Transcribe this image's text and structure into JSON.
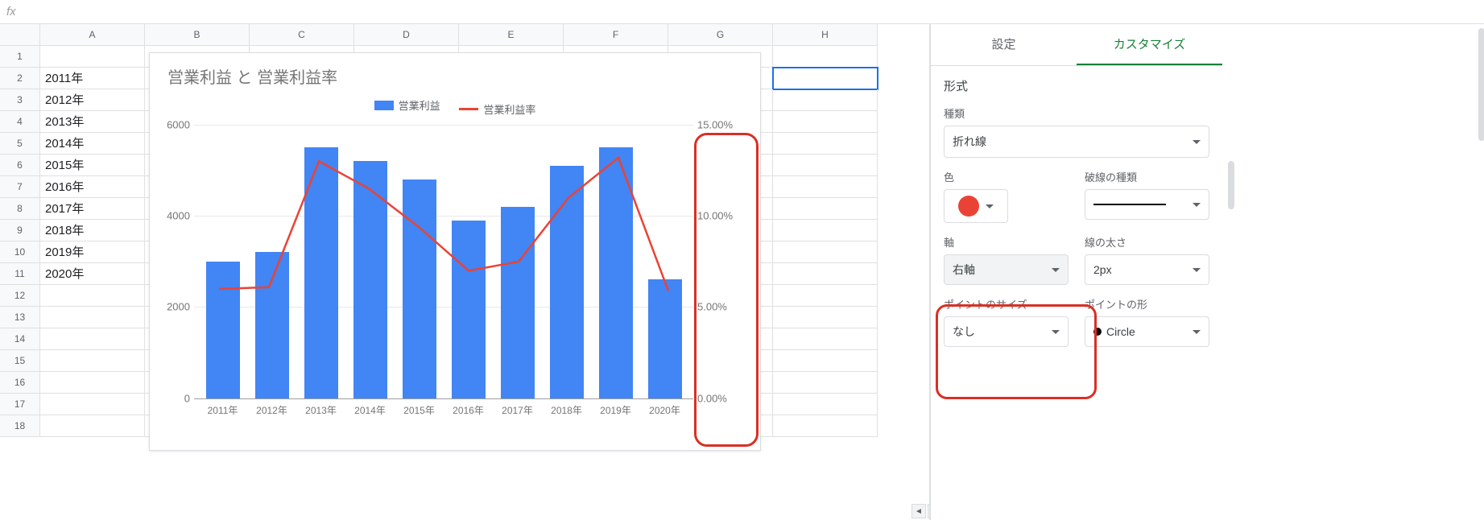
{
  "formula_bar": {
    "fx": "fx",
    "value": ""
  },
  "columns": [
    "A",
    "B",
    "C",
    "D",
    "E",
    "F",
    "G",
    "H"
  ],
  "row_numbers": [
    "1",
    "2",
    "3",
    "4",
    "5",
    "6",
    "7",
    "8",
    "9",
    "10",
    "11",
    "12",
    "13",
    "14",
    "15",
    "16",
    "17",
    "18"
  ],
  "cells_colA": [
    "",
    "2011年",
    "2012年",
    "2013年",
    "2014年",
    "2015年",
    "2016年",
    "2017年",
    "2018年",
    "2019年",
    "2020年",
    "",
    "",
    "",
    "",
    "",
    "",
    ""
  ],
  "selected_cell": "H2",
  "chart_data": {
    "type": "combo",
    "title": "営業利益 と 営業利益率",
    "series": [
      {
        "name": "営業利益",
        "type": "bar",
        "axis": "left",
        "color": "#4285f4",
        "values": [
          3000,
          3200,
          5500,
          5200,
          4800,
          3900,
          4200,
          5100,
          5500,
          2600
        ]
      },
      {
        "name": "営業利益率",
        "type": "line",
        "axis": "right",
        "color": "#ea4335",
        "values": [
          6.0,
          6.1,
          13.0,
          11.5,
          9.4,
          7.0,
          7.5,
          11.0,
          13.2,
          5.9
        ]
      }
    ],
    "categories": [
      "2011年",
      "2012年",
      "2013年",
      "2014年",
      "2015年",
      "2016年",
      "2017年",
      "2018年",
      "2019年",
      "2020年"
    ],
    "y_left": {
      "min": 0,
      "max": 6000,
      "ticks": [
        0,
        2000,
        4000,
        6000
      ]
    },
    "y_right": {
      "min": 0,
      "max": 15,
      "ticks_labels": [
        "0.00%",
        "5.00%",
        "10.00%",
        "15.00%"
      ]
    },
    "legend": {
      "bar": "営業利益",
      "line": "営業利益率"
    }
  },
  "sidebar": {
    "tabs": {
      "settings": "設定",
      "customize": "カスタマイズ"
    },
    "format_label": "形式",
    "type_label": "種類",
    "type_value": "折れ線",
    "color_label": "色",
    "dash_label": "破線の種類",
    "axis_label": "軸",
    "axis_value": "右軸",
    "line_width_label": "線の太さ",
    "line_width_value": "2px",
    "point_size_label": "ポイントのサイズ",
    "point_size_value": "なし",
    "point_shape_label": "ポイントの形",
    "point_shape_value": "Circle"
  }
}
